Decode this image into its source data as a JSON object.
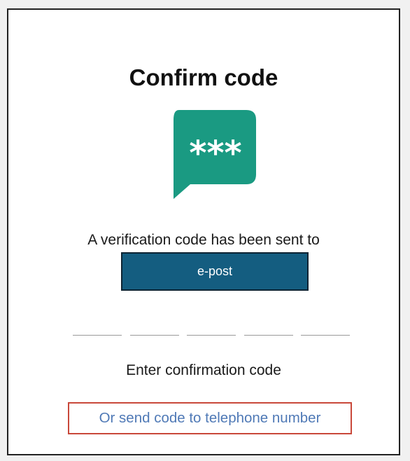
{
  "dialog": {
    "title": "Confirm code",
    "sent_message": "A verification code has been sent to",
    "recipient": "e-post",
    "code_slots": [
      "",
      "",
      "",
      "",
      ""
    ],
    "enter_label": "Enter confirmation code",
    "alt_link": "Or send code to telephone number"
  },
  "icon": {
    "name": "password-message-icon",
    "glyph": "***"
  },
  "colors": {
    "icon_green": "#1a9a82",
    "recipient_bg": "#145d80",
    "link": "#4f79b6",
    "highlight_border": "#c9483a"
  }
}
